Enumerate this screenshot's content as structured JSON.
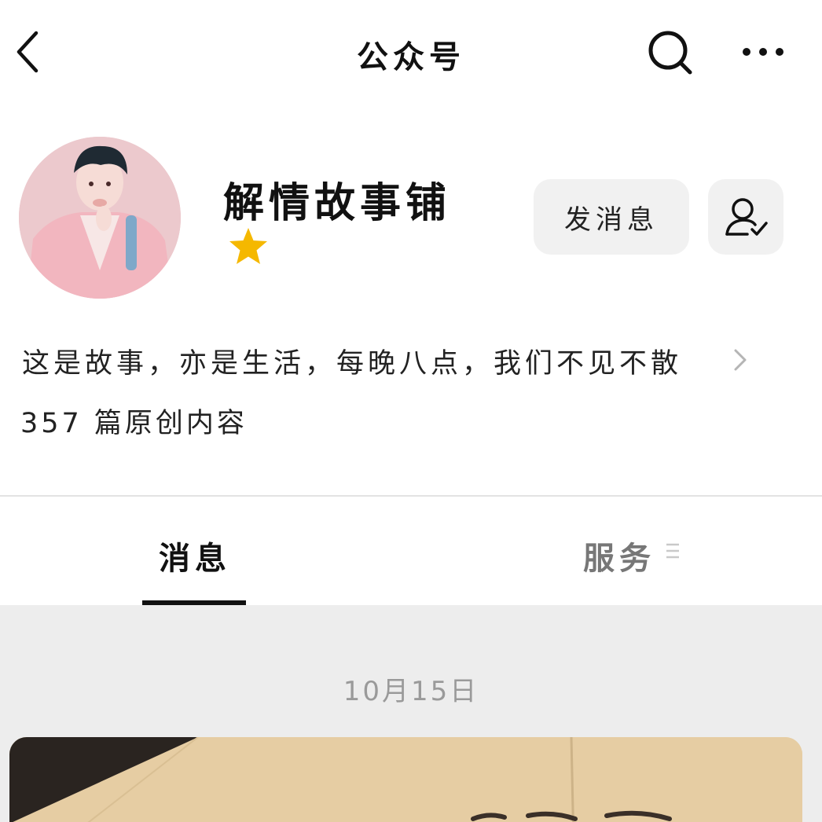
{
  "header": {
    "title": "公众号",
    "back_icon": "chevron-left-icon",
    "search_icon": "search-icon",
    "more_icon": "more-horizontal-icon"
  },
  "profile": {
    "name": "解情故事铺",
    "badge_icon": "star-icon",
    "badge_color": "#f5b800",
    "send_message_label": "发消息",
    "follow_icon": "user-followed-icon",
    "intro": "这是故事，亦是生活，每晚八点，我们不见不散",
    "article_count": "357 篇原创内容"
  },
  "tabs": {
    "messages": "消息",
    "services": "服务"
  },
  "feed": {
    "date": "10月15日"
  },
  "colors": {
    "button_bg": "#f1f1f1",
    "feed_bg": "#ededed",
    "active_tab": "#111111",
    "inactive_tab": "#777777"
  }
}
